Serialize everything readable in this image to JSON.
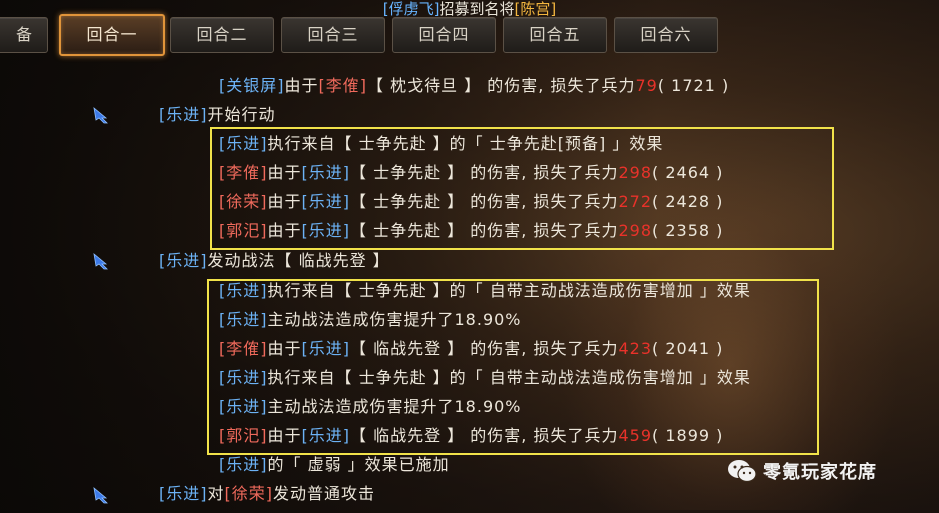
{
  "banner": {
    "pre_name": "[俘虏飞]",
    "mid": "招募到名将",
    "post_name": "[陈宫]"
  },
  "tabs": [
    "备",
    "回合一",
    "回合二",
    "回合三",
    "回合四",
    "回合五",
    "回合六"
  ],
  "log": {
    "l0": {
      "a": "[关银屏]",
      "b": "由于",
      "c": "[李傕]",
      "d": "【 枕戈待旦 】 的伤害, 损失了兵力",
      "e": "79",
      "f": "( 1721 )"
    },
    "l1": {
      "a": "[乐进]",
      "b": "开始行动"
    },
    "l2": {
      "a": "[乐进]",
      "b": "执行来自【 士争先赴 】的「 士争先赴[预备] 」效果"
    },
    "l3": {
      "a": "[李傕]",
      "b": "由于",
      "c": "[乐进]",
      "d": "【 士争先赴 】 的伤害, 损失了兵力",
      "e": "298",
      "f": "( 2464 )"
    },
    "l4": {
      "a": "[徐荣]",
      "b": "由于",
      "c": "[乐进]",
      "d": "【 士争先赴 】 的伤害, 损失了兵力",
      "e": "272",
      "f": "( 2428 )"
    },
    "l5": {
      "a": "[郭汜]",
      "b": "由于",
      "c": "[乐进]",
      "d": "【 士争先赴 】 的伤害, 损失了兵力",
      "e": "298",
      "f": "( 2358 )"
    },
    "l6": {
      "a": "[乐进]",
      "b": "发动战法【 临战先登 】"
    },
    "l7": {
      "a": "[乐进]",
      "b": "执行来自【 士争先赴 】的「 自带主动战法造成伤害增加 」效果"
    },
    "l8": {
      "a": "[乐进]",
      "b": "主动战法造成伤害提升了18.90%"
    },
    "l9": {
      "a": "[李傕]",
      "b": "由于",
      "c": "[乐进]",
      "d": "【 临战先登 】 的伤害, 损失了兵力",
      "e": "423",
      "f": "( 2041 )"
    },
    "l10": {
      "a": "[乐进]",
      "b": "执行来自【 士争先赴 】的「 自带主动战法造成伤害增加 」效果"
    },
    "l11": {
      "a": "[乐进]",
      "b": "主动战法造成伤害提升了18.90%"
    },
    "l12": {
      "a": "[郭汜]",
      "b": "由于",
      "c": "[乐进]",
      "d": "【 临战先登 】 的伤害, 损失了兵力",
      "e": "459",
      "f": "( 1899 )"
    },
    "l13": {
      "a": "[乐进]",
      "b": "的「 虚弱 」效果已施加"
    },
    "l14": {
      "a": "[乐进]",
      "b": "对",
      "c": "[徐荣]",
      "d": "发动普通攻击"
    }
  },
  "watermark": "零氪玩家花席",
  "icons": {
    "action": "blue-arrow-icon",
    "wechat": "wechat-icon"
  },
  "colors": {
    "ally": "#6cb2f5",
    "enemy": "#f06a5c",
    "damage": "#e8322a",
    "highlight_box": "#f1e24a",
    "active_tab": "#e0943a"
  }
}
